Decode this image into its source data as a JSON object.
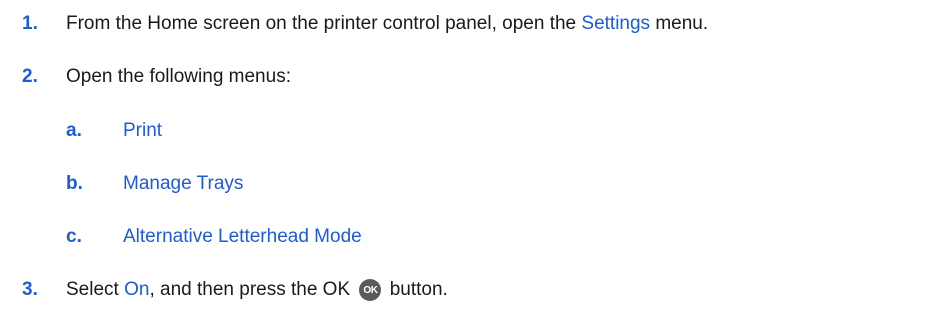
{
  "steps": [
    {
      "number": "1.",
      "text_before": "From the Home screen on the printer control panel, open the ",
      "link": "Settings",
      "text_after": " menu."
    },
    {
      "number": "2.",
      "text": "Open the following menus:",
      "substeps": [
        {
          "letter": "a.",
          "label": "Print"
        },
        {
          "letter": "b.",
          "label": "Manage Trays"
        },
        {
          "letter": "c.",
          "label": "Alternative Letterhead Mode"
        }
      ]
    },
    {
      "number": "3.",
      "text_before": "Select ",
      "link": "On",
      "text_middle": ", and then press the OK ",
      "ok_glyph": "OK",
      "text_after": " button."
    }
  ],
  "colors": {
    "accent": "#1f5bd6",
    "text": "#1a1a1a",
    "ok_button": "#5a5a5a"
  }
}
